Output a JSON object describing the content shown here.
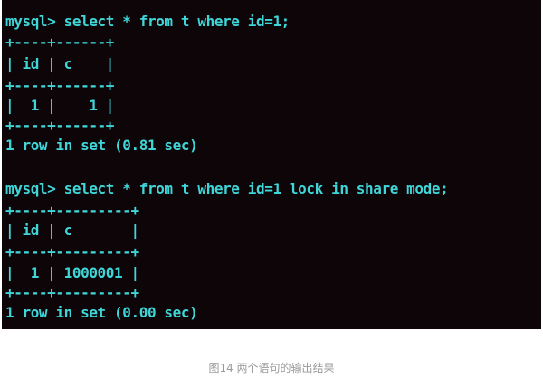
{
  "terminal": {
    "lines": [
      "mysql> select * from t where id=1;",
      "+----+------+",
      "| id | c    |",
      "+----+------+",
      "|  1 |    1 |",
      "+----+------+",
      "1 row in set (0.81 sec)",
      "",
      "mysql> select * from t where id=1 lock in share mode;",
      "+----+---------+",
      "| id | c       |",
      "+----+---------+",
      "|  1 | 1000001 |",
      "+----+---------+",
      "1 row in set (0.00 sec)"
    ],
    "colors": {
      "background": "#0e0509",
      "text": "#3fd6d8"
    }
  },
  "caption": "图14 两个语句的输出结果"
}
